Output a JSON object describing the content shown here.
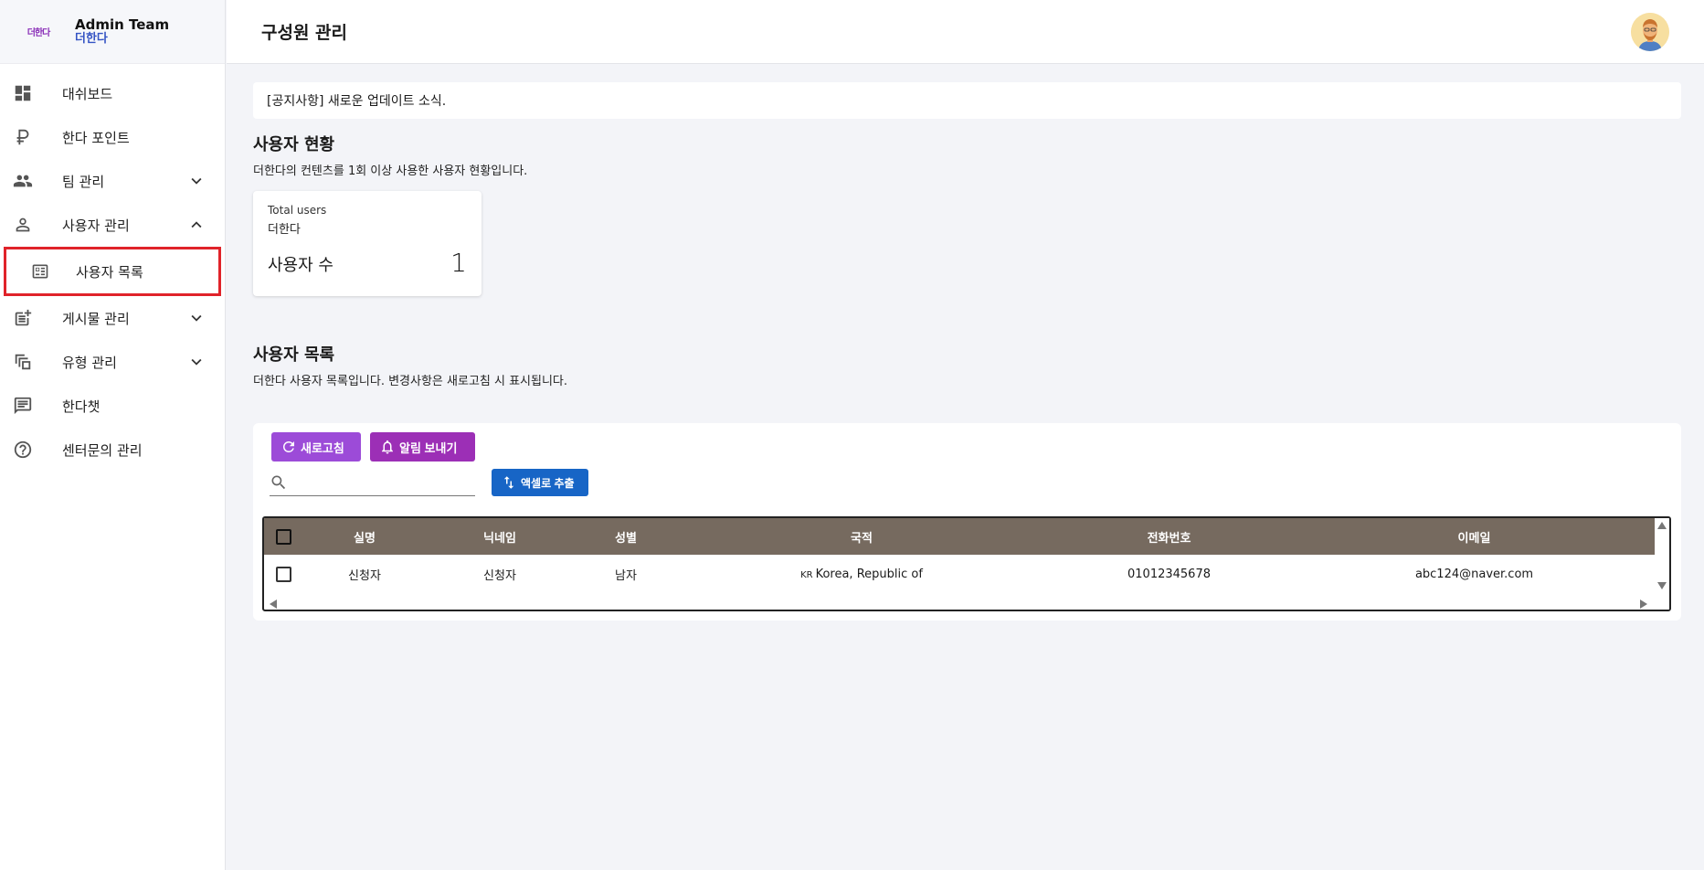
{
  "brand": {
    "logo_text": "더한다",
    "title": "Admin Team",
    "subtitle": "더한다"
  },
  "sidebar": {
    "items": [
      {
        "label": "대쉬보드",
        "icon": "dashboard-icon"
      },
      {
        "label": "한다 포인트",
        "icon": "ruble-icon"
      },
      {
        "label": "팀 관리",
        "icon": "people-icon",
        "chevron": "down"
      },
      {
        "label": "사용자 관리",
        "icon": "person-icon",
        "chevron": "up"
      },
      {
        "label": "사용자 목록",
        "icon": "list-card-icon",
        "sub": true,
        "highlighted": true
      },
      {
        "label": "게시물 관리",
        "icon": "post-add-icon",
        "chevron": "down"
      },
      {
        "label": "유형 관리",
        "icon": "copy-icon",
        "chevron": "down"
      },
      {
        "label": "한다챗",
        "icon": "chat-icon"
      },
      {
        "label": "센터문의 관리",
        "icon": "help-icon"
      }
    ]
  },
  "header": {
    "title": "구성원 관리"
  },
  "notice": "[공지사항] 새로운 업데이트 소식.",
  "status_section": {
    "title": "사용자 현황",
    "description": "더한다의 컨텐츠를 1회 이상 사용한 사용자 현황입니다.",
    "card": {
      "label": "Total users",
      "brand": "더한다",
      "name": "사용자 수",
      "value": "1"
    }
  },
  "list_section": {
    "title": "사용자 목록",
    "description": "더한다 사용자 목록입니다. 변경사항은 새로고침 시 표시됩니다.",
    "buttons": {
      "refresh": "새로고침",
      "notify": "알림 보내기",
      "excel": "액셀로 추출"
    },
    "search_placeholder": "",
    "columns": [
      "실명",
      "닉네임",
      "성별",
      "국적",
      "전화번호",
      "이메일"
    ],
    "rows": [
      {
        "name": "신청자",
        "nickname": "신청자",
        "gender": "남자",
        "flag": "KR",
        "nationality": "Korea, Republic of",
        "phone": "01012345678",
        "email": "abc124@naver.com"
      }
    ]
  },
  "colors": {
    "accent_purple": "#9c4bd8",
    "notify_purple": "#9c2fb6",
    "excel_blue": "#1765c6",
    "table_header": "#766a5f",
    "highlight_red": "#e0232a"
  }
}
